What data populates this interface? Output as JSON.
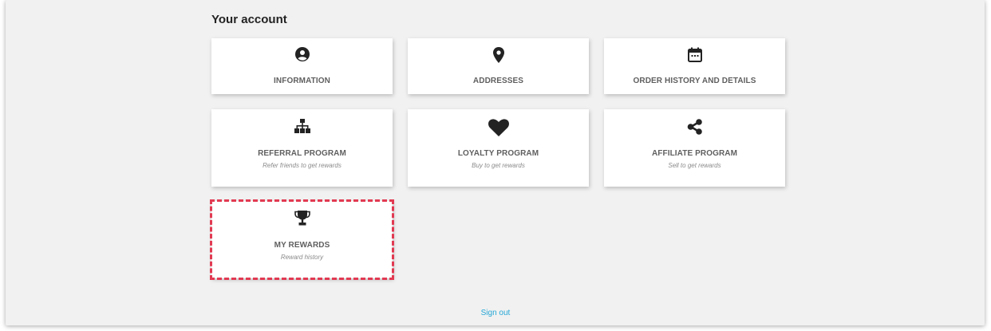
{
  "page": {
    "title": "Your account"
  },
  "tiles": [
    {
      "label": "INFORMATION",
      "icon": "user-circle-icon"
    },
    {
      "label": "ADDRESSES",
      "icon": "map-pin-icon"
    },
    {
      "label": "ORDER HISTORY AND DETAILS",
      "icon": "calendar-icon"
    },
    {
      "label": "REFERRAL PROGRAM",
      "sub": "Refer friends to get rewards",
      "icon": "sitemap-icon"
    },
    {
      "label": "LOYALTY PROGRAM",
      "sub": "Buy to get rewards",
      "icon": "heart-icon"
    },
    {
      "label": "AFFILIATE PROGRAM",
      "sub": "Sell to get rewards",
      "icon": "share-icon"
    },
    {
      "label": "MY REWARDS",
      "sub": "Reward history",
      "icon": "trophy-icon"
    }
  ],
  "footer": {
    "signout_label": "Sign out"
  },
  "colors": {
    "link": "#24a6d6",
    "highlight": "#e23a52",
    "icon": "#232323"
  }
}
